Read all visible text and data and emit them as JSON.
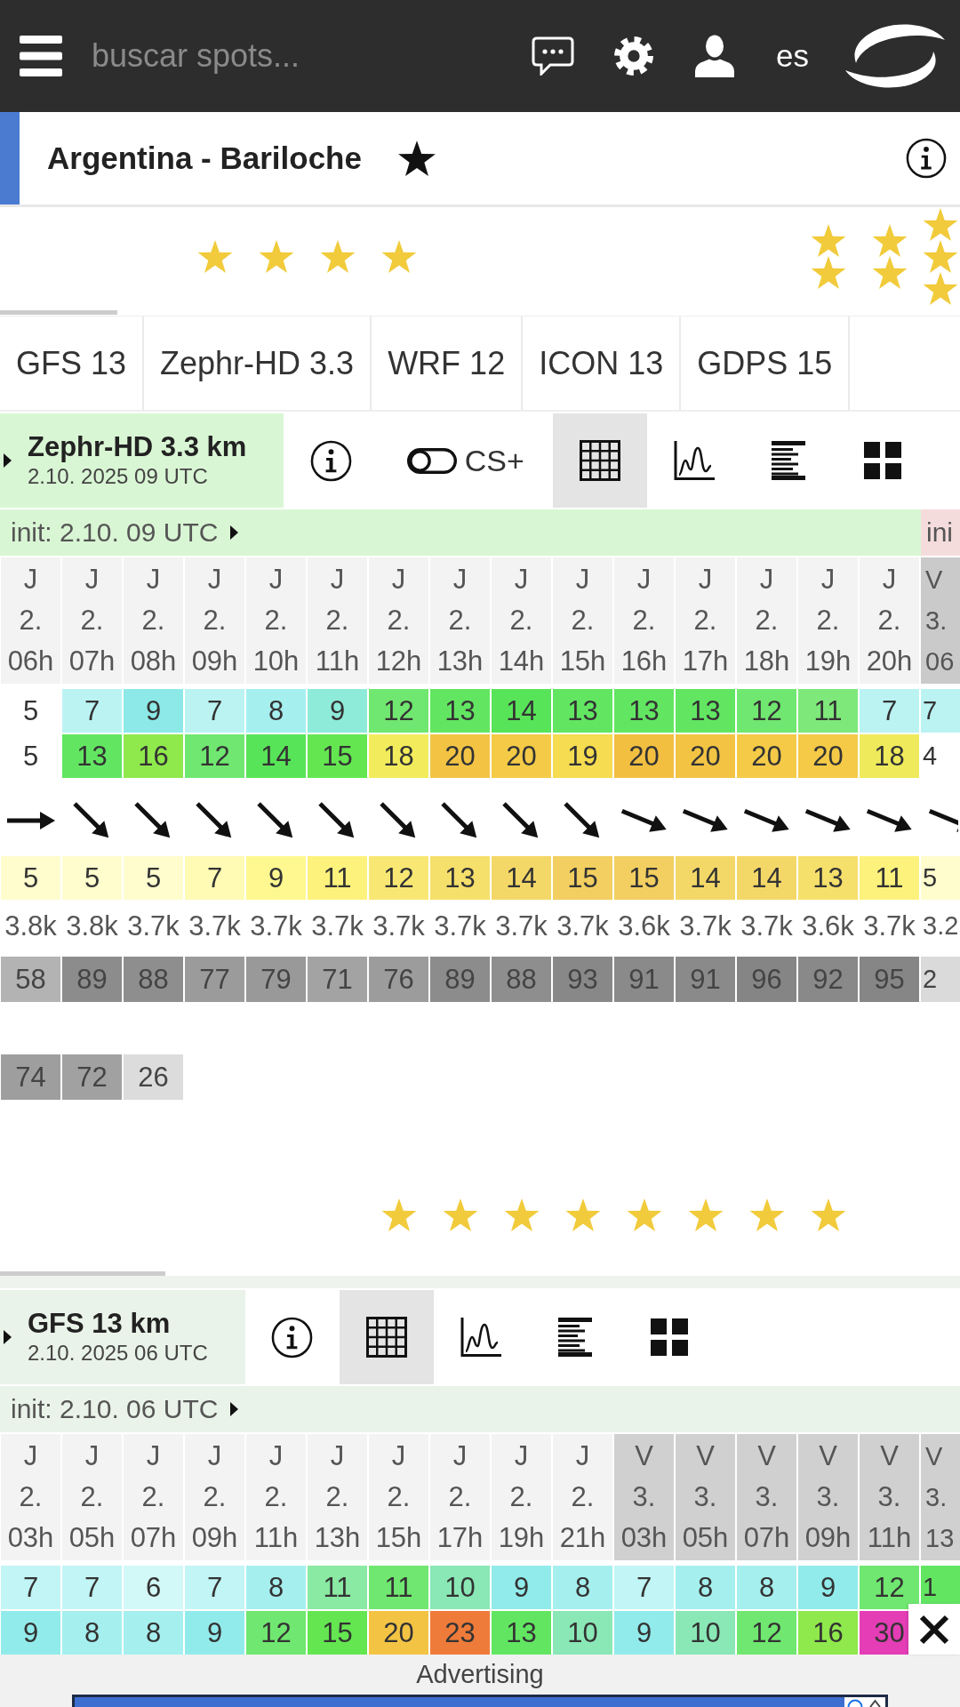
{
  "header": {
    "search": {
      "placeholder": "buscar spots..."
    },
    "language": "es"
  },
  "spot": {
    "name": "Argentina - Bariloche",
    "favorite": true
  },
  "top_star_marks": [
    {
      "kind": "none"
    },
    {
      "kind": "none"
    },
    {
      "kind": "none"
    },
    {
      "kind": "single"
    },
    {
      "kind": "single"
    },
    {
      "kind": "single"
    },
    {
      "kind": "single"
    },
    {
      "kind": "none"
    },
    {
      "kind": "none"
    },
    {
      "kind": "none"
    },
    {
      "kind": "none"
    },
    {
      "kind": "none"
    },
    {
      "kind": "none"
    },
    {
      "kind": "double"
    },
    {
      "kind": "double"
    },
    {
      "kind": "triple"
    }
  ],
  "model_tabs": [
    {
      "label": "GFS 13"
    },
    {
      "label": "Zephr-HD 3.3"
    },
    {
      "label": "WRF 12"
    },
    {
      "label": "ICON 13"
    },
    {
      "label": "GDPS 15"
    }
  ],
  "forecasts": [
    {
      "model": "Zephr-HD 3.3 km",
      "run": "2.10. 2025 09 UTC",
      "color": "#d9f6d4",
      "tools": [
        {
          "kind": "info",
          "selected": false
        },
        {
          "kind": "toggle",
          "label": "CS+",
          "on": false,
          "selected": false
        },
        {
          "kind": "table",
          "selected": true
        },
        {
          "kind": "graph",
          "selected": false
        },
        {
          "kind": "list",
          "selected": false
        },
        {
          "kind": "tiles",
          "selected": false
        }
      ],
      "init": "init: 2.10. 09 UTC",
      "next_init": {
        "label": "ini",
        "color": "#f5dcdc"
      },
      "columns": [
        {
          "day": "J",
          "date": "2.",
          "hour": "06h",
          "color": "#f3f3f3"
        },
        {
          "day": "J",
          "date": "2.",
          "hour": "07h",
          "color": "#f3f3f3"
        },
        {
          "day": "J",
          "date": "2.",
          "hour": "08h",
          "color": "#f3f3f3"
        },
        {
          "day": "J",
          "date": "2.",
          "hour": "09h",
          "color": "#f3f3f3"
        },
        {
          "day": "J",
          "date": "2.",
          "hour": "10h",
          "color": "#f3f3f3"
        },
        {
          "day": "J",
          "date": "2.",
          "hour": "11h",
          "color": "#f3f3f3"
        },
        {
          "day": "J",
          "date": "2.",
          "hour": "12h",
          "color": "#f3f3f3"
        },
        {
          "day": "J",
          "date": "2.",
          "hour": "13h",
          "color": "#f3f3f3"
        },
        {
          "day": "J",
          "date": "2.",
          "hour": "14h",
          "color": "#f3f3f3"
        },
        {
          "day": "J",
          "date": "2.",
          "hour": "15h",
          "color": "#f3f3f3"
        },
        {
          "day": "J",
          "date": "2.",
          "hour": "16h",
          "color": "#f3f3f3"
        },
        {
          "day": "J",
          "date": "2.",
          "hour": "17h",
          "color": "#f3f3f3"
        },
        {
          "day": "J",
          "date": "2.",
          "hour": "18h",
          "color": "#f3f3f3"
        },
        {
          "day": "J",
          "date": "2.",
          "hour": "19h",
          "color": "#f3f3f3"
        },
        {
          "day": "J",
          "date": "2.",
          "hour": "20h",
          "color": "#f3f3f3"
        },
        {
          "day": "V",
          "date": "3.",
          "hour": "06",
          "color": "#cacaca"
        }
      ],
      "rows": [
        {
          "kind": "wind",
          "cells": [
            {
              "value": "5",
              "color": "#ffffff"
            },
            {
              "value": "7",
              "color": "#bbf3f3"
            },
            {
              "value": "9",
              "color": "#8ce9e7"
            },
            {
              "value": "7",
              "color": "#bbf3f3"
            },
            {
              "value": "8",
              "color": "#a6efef"
            },
            {
              "value": "9",
              "color": "#8febd9"
            },
            {
              "value": "12",
              "color": "#70e770"
            },
            {
              "value": "13",
              "color": "#62e662"
            },
            {
              "value": "14",
              "color": "#58e458"
            },
            {
              "value": "13",
              "color": "#62e662"
            },
            {
              "value": "13",
              "color": "#62e662"
            },
            {
              "value": "13",
              "color": "#62e662"
            },
            {
              "value": "12",
              "color": "#70e770"
            },
            {
              "value": "11",
              "color": "#7ee87a"
            },
            {
              "value": "7",
              "color": "#bbf3f3"
            },
            {
              "value": "7",
              "color": "#bbf3f3"
            }
          ]
        },
        {
          "kind": "gust",
          "cells": [
            {
              "value": "5",
              "color": "#ffffff"
            },
            {
              "value": "13",
              "color": "#62e662"
            },
            {
              "value": "16",
              "color": "#8fe84c"
            },
            {
              "value": "12",
              "color": "#70e770"
            },
            {
              "value": "14",
              "color": "#58e458"
            },
            {
              "value": "15",
              "color": "#64e651"
            },
            {
              "value": "18",
              "color": "#f2ec5c"
            },
            {
              "value": "20",
              "color": "#f3c444"
            },
            {
              "value": "20",
              "color": "#f4ca47"
            },
            {
              "value": "19",
              "color": "#f5dc50"
            },
            {
              "value": "20",
              "color": "#f2bf41"
            },
            {
              "value": "20",
              "color": "#f3c444"
            },
            {
              "value": "20",
              "color": "#f4ca47"
            },
            {
              "value": "20",
              "color": "#f4ca47"
            },
            {
              "value": "18",
              "color": "#efea5b"
            },
            {
              "value": "4",
              "color": "#ffffff"
            }
          ]
        },
        {
          "kind": "direction",
          "cells": [
            {
              "kind": "e"
            },
            {
              "kind": "se"
            },
            {
              "kind": "se"
            },
            {
              "kind": "se"
            },
            {
              "kind": "se"
            },
            {
              "kind": "se"
            },
            {
              "kind": "se"
            },
            {
              "kind": "se"
            },
            {
              "kind": "se"
            },
            {
              "kind": "se"
            },
            {
              "kind": "ese"
            },
            {
              "kind": "ese"
            },
            {
              "kind": "ese"
            },
            {
              "kind": "ese"
            },
            {
              "kind": "ese"
            },
            {
              "kind": "ese"
            }
          ]
        },
        {
          "kind": "temperature",
          "cells": [
            {
              "value": "5",
              "color": "#fffcce"
            },
            {
              "value": "5",
              "color": "#fffcce"
            },
            {
              "value": "5",
              "color": "#fffcce"
            },
            {
              "value": "7",
              "color": "#fffab4"
            },
            {
              "value": "9",
              "color": "#fff890"
            },
            {
              "value": "11",
              "color": "#fcf27c"
            },
            {
              "value": "12",
              "color": "#f8e873"
            },
            {
              "value": "13",
              "color": "#f6e06c"
            },
            {
              "value": "14",
              "color": "#f4d867"
            },
            {
              "value": "15",
              "color": "#f2cf60"
            },
            {
              "value": "15",
              "color": "#f2cf60"
            },
            {
              "value": "14",
              "color": "#f4d867"
            },
            {
              "value": "14",
              "color": "#f4d867"
            },
            {
              "value": "13",
              "color": "#f6e06c"
            },
            {
              "value": "11",
              "color": "#fcf27c"
            },
            {
              "value": "5",
              "color": "#fffcce"
            }
          ]
        },
        {
          "kind": "altitude",
          "cells": [
            {
              "value": "3.8k"
            },
            {
              "value": "3.8k"
            },
            {
              "value": "3.7k"
            },
            {
              "value": "3.7k"
            },
            {
              "value": "3.7k"
            },
            {
              "value": "3.7k"
            },
            {
              "value": "3.7k"
            },
            {
              "value": "3.7k"
            },
            {
              "value": "3.7k"
            },
            {
              "value": "3.7k"
            },
            {
              "value": "3.6k"
            },
            {
              "value": "3.7k"
            },
            {
              "value": "3.7k"
            },
            {
              "value": "3.6k"
            },
            {
              "value": "3.7k"
            },
            {
              "value": "3.2"
            }
          ]
        },
        {
          "kind": "cloud",
          "cells": [
            {
              "value": "58",
              "color": "#b3b3b3"
            },
            {
              "value": "89",
              "color": "#8c8c8c"
            },
            {
              "value": "88",
              "color": "#8e8e8e"
            },
            {
              "value": "77",
              "color": "#9b9b9b"
            },
            {
              "value": "79",
              "color": "#999999"
            },
            {
              "value": "71",
              "color": "#a3a3a3"
            },
            {
              "value": "76",
              "color": "#9c9c9c"
            },
            {
              "value": "89",
              "color": "#8c8c8c"
            },
            {
              "value": "88",
              "color": "#8e8e8e"
            },
            {
              "value": "93",
              "color": "#888888"
            },
            {
              "value": "91",
              "color": "#8a8a8a"
            },
            {
              "value": "91",
              "color": "#8a8a8a"
            },
            {
              "value": "96",
              "color": "#858585"
            },
            {
              "value": "92",
              "color": "#898989"
            },
            {
              "value": "95",
              "color": "#868686"
            },
            {
              "value": "2",
              "color": "#dadada"
            }
          ]
        },
        {
          "kind": "cloud",
          "cells": [
            {
              "value": "74",
              "color": "#9e9e9e"
            },
            {
              "value": "72",
              "color": "#a1a1a1"
            },
            {
              "value": "26",
              "color": "#dcdcdc"
            }
          ]
        }
      ],
      "star_marks": [
        {
          "kind": "none"
        },
        {
          "kind": "none"
        },
        {
          "kind": "none"
        },
        {
          "kind": "none"
        },
        {
          "kind": "none"
        },
        {
          "kind": "none"
        },
        {
          "kind": "single"
        },
        {
          "kind": "single"
        },
        {
          "kind": "single"
        },
        {
          "kind": "single"
        },
        {
          "kind": "single"
        },
        {
          "kind": "single"
        },
        {
          "kind": "single"
        },
        {
          "kind": "single"
        },
        {
          "kind": "none"
        },
        {
          "kind": "none"
        }
      ]
    },
    {
      "model": "GFS 13 km",
      "run": "2.10. 2025 06 UTC",
      "color": "#e9f3e9",
      "tools": [
        {
          "kind": "info",
          "selected": false
        },
        {
          "kind": "table",
          "selected": true
        },
        {
          "kind": "graph",
          "selected": false
        },
        {
          "kind": "list",
          "selected": false
        },
        {
          "kind": "tiles",
          "selected": false
        }
      ],
      "init": "init: 2.10. 06 UTC",
      "columns": [
        {
          "day": "J",
          "date": "2.",
          "hour": "03h",
          "color": "#f3f3f3"
        },
        {
          "day": "J",
          "date": "2.",
          "hour": "05h",
          "color": "#f3f3f3"
        },
        {
          "day": "J",
          "date": "2.",
          "hour": "07h",
          "color": "#f3f3f3"
        },
        {
          "day": "J",
          "date": "2.",
          "hour": "09h",
          "color": "#f3f3f3"
        },
        {
          "day": "J",
          "date": "2.",
          "hour": "11h",
          "color": "#f3f3f3"
        },
        {
          "day": "J",
          "date": "2.",
          "hour": "13h",
          "color": "#f3f3f3"
        },
        {
          "day": "J",
          "date": "2.",
          "hour": "15h",
          "color": "#f3f3f3"
        },
        {
          "day": "J",
          "date": "2.",
          "hour": "17h",
          "color": "#f3f3f3"
        },
        {
          "day": "J",
          "date": "2.",
          "hour": "19h",
          "color": "#f3f3f3"
        },
        {
          "day": "J",
          "date": "2.",
          "hour": "21h",
          "color": "#f3f3f3"
        },
        {
          "day": "V",
          "date": "3.",
          "hour": "03h",
          "color": "#d0d0d0"
        },
        {
          "day": "V",
          "date": "3.",
          "hour": "05h",
          "color": "#d0d0d0"
        },
        {
          "day": "V",
          "date": "3.",
          "hour": "07h",
          "color": "#d0d0d0"
        },
        {
          "day": "V",
          "date": "3.",
          "hour": "09h",
          "color": "#d0d0d0"
        },
        {
          "day": "V",
          "date": "3.",
          "hour": "11h",
          "color": "#d0d0d0"
        },
        {
          "day": "V",
          "date": "3.",
          "hour": "13",
          "color": "#d0d0d0"
        }
      ],
      "rows": [
        {
          "kind": "wind",
          "cells": [
            {
              "value": "7",
              "color": "#c2f5f5"
            },
            {
              "value": "7",
              "color": "#c2f5f5"
            },
            {
              "value": "6",
              "color": "#d3f8f8"
            },
            {
              "value": "7",
              "color": "#c2f5f5"
            },
            {
              "value": "8",
              "color": "#a6efef"
            },
            {
              "value": "11",
              "color": "#8ae9a2"
            },
            {
              "value": "11",
              "color": "#70e770"
            },
            {
              "value": "10",
              "color": "#8ae8b6"
            },
            {
              "value": "9",
              "color": "#92ebeb"
            },
            {
              "value": "8",
              "color": "#a6efef"
            },
            {
              "value": "7",
              "color": "#c2f5f5"
            },
            {
              "value": "8",
              "color": "#a6efef"
            },
            {
              "value": "8",
              "color": "#a6efef"
            },
            {
              "value": "9",
              "color": "#92ebeb"
            },
            {
              "value": "12",
              "color": "#70e770"
            },
            {
              "value": "1",
              "color": "#62e662"
            }
          ]
        },
        {
          "kind": "gust",
          "cells": [
            {
              "value": "9",
              "color": "#92ebeb"
            },
            {
              "value": "8",
              "color": "#a6efef"
            },
            {
              "value": "8",
              "color": "#a6efef"
            },
            {
              "value": "9",
              "color": "#92ebeb"
            },
            {
              "value": "12",
              "color": "#70e770"
            },
            {
              "value": "15",
              "color": "#64e651"
            },
            {
              "value": "20",
              "color": "#f3c444"
            },
            {
              "value": "23",
              "color": "#ee7b3a"
            },
            {
              "value": "13",
              "color": "#62e662"
            },
            {
              "value": "10",
              "color": "#8ae8b6"
            },
            {
              "value": "9",
              "color": "#92ebeb"
            },
            {
              "value": "10",
              "color": "#8ae8b6"
            },
            {
              "value": "12",
              "color": "#70e770"
            },
            {
              "value": "16",
              "color": "#8fe84c"
            },
            {
              "value": "30",
              "color": "#e43db6"
            }
          ]
        }
      ]
    }
  ],
  "advertising": {
    "label": "Advertising"
  }
}
